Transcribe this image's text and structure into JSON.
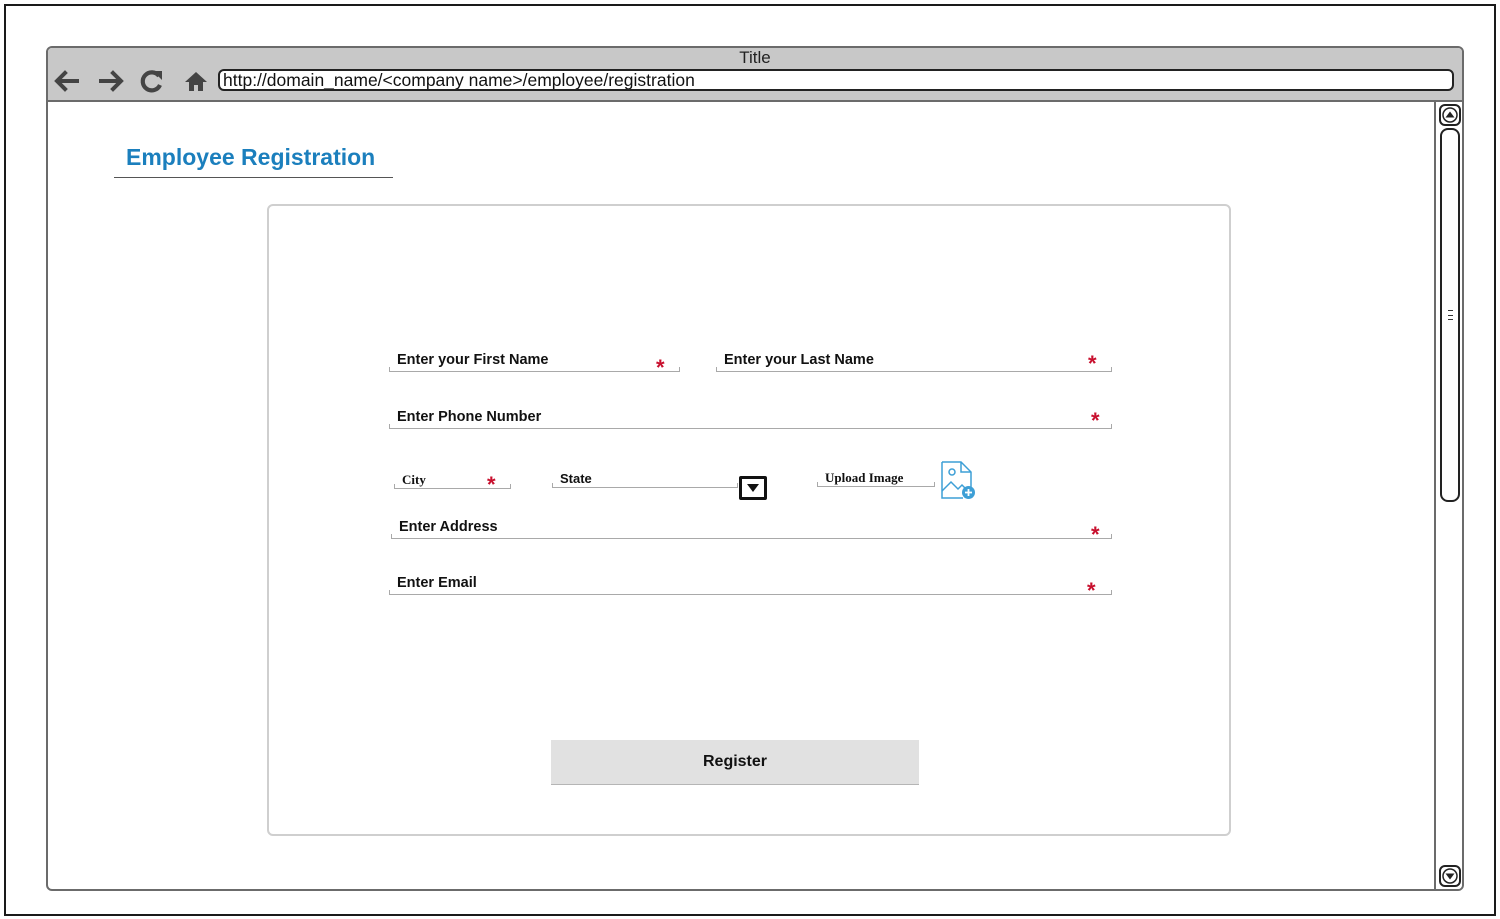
{
  "window": {
    "title": "Title"
  },
  "browser": {
    "url": "http://domain_name/<company name>/employee/registration",
    "nav_icons": [
      "back-arrow-icon",
      "forward-arrow-icon",
      "reload-icon",
      "home-icon"
    ]
  },
  "page": {
    "title": "Employee Registration"
  },
  "form": {
    "first_name": {
      "label": "Enter your First Name",
      "required_mark": "*"
    },
    "last_name": {
      "label": "Enter your Last Name",
      "required_mark": "*"
    },
    "phone": {
      "label": "Enter Phone Number",
      "required_mark": "*"
    },
    "city": {
      "label": "City",
      "required_mark": "*"
    },
    "state": {
      "label": "State"
    },
    "upload": {
      "label": "Upload Image",
      "icon": "image-upload-icon"
    },
    "address": {
      "label": "Enter Address",
      "required_mark": "*"
    },
    "email": {
      "label": "Enter Email",
      "required_mark": "*"
    },
    "submit_label": "Register"
  },
  "colors": {
    "title_blue": "#1b7fbd",
    "required_red": "#c8102e",
    "chrome_gray": "#c8c8c8",
    "button_gray": "#e1e1e1"
  }
}
